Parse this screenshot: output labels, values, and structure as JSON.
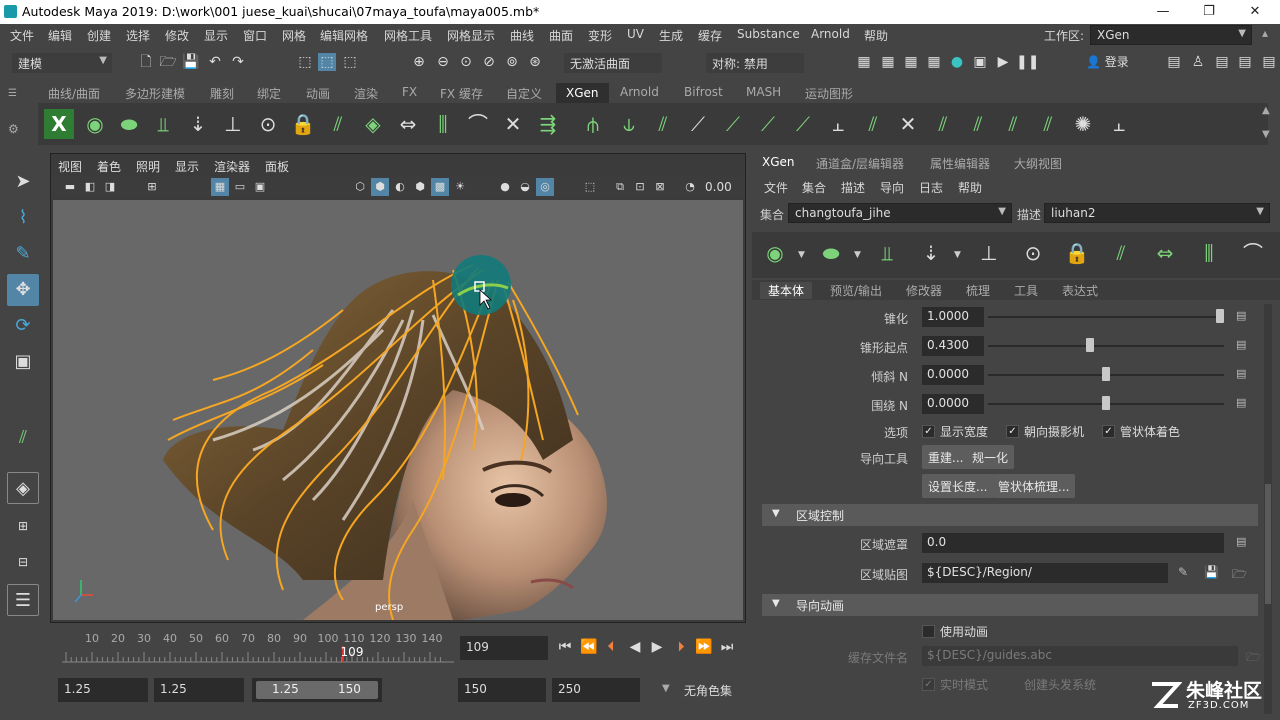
{
  "title_bar": {
    "title": "Autodesk Maya 2019: D:\\work\\001 juese_kuai\\shucai\\07maya_toufa\\maya005.mb*",
    "minimize": "—",
    "restore": "❐",
    "close": "✕"
  },
  "menu": [
    "文件",
    "编辑",
    "创建",
    "选择",
    "修改",
    "显示",
    "窗口",
    "网格",
    "编辑网格",
    "网格工具",
    "网格显示",
    "曲线",
    "曲面",
    "变形",
    "UV",
    "生成",
    "缓存",
    "Substance",
    "Arnold",
    "帮助"
  ],
  "workspace": {
    "label": "工作区:",
    "value": "XGen"
  },
  "status_line": {
    "mode": "建模",
    "live_surface": "无激活曲面",
    "symmetry": "对称: 禁用",
    "login": "登录"
  },
  "shelf_tabs": [
    "曲线/曲面",
    "多边形建模",
    "雕刻",
    "绑定",
    "动画",
    "渲染",
    "FX",
    "FX 缓存",
    "自定义",
    "XGen",
    "Arnold",
    "Bifrost",
    "MASH",
    "运动图形"
  ],
  "shelf_active": "XGen",
  "viewport": {
    "menus": [
      "视图",
      "着色",
      "照明",
      "显示",
      "渲染器",
      "面板"
    ],
    "exposure": "0.00",
    "camera_label": "persp"
  },
  "timeline": {
    "ticks": [
      "10",
      "20",
      "30",
      "40",
      "50",
      "60",
      "70",
      "80",
      "90",
      "100",
      "110",
      "120",
      "130",
      "140"
    ],
    "current_frame_marker": "109",
    "current_frame": "109"
  },
  "range": {
    "start": "1.25",
    "anim_start": "1.25",
    "slider_start": "1.25",
    "slider_end": "150",
    "anim_end": "150",
    "end": "250",
    "character_set": "无角色集"
  },
  "right_panel": {
    "tabs": [
      "XGen",
      "通道盒/层编辑器",
      "属性编辑器",
      "大纲视图"
    ],
    "active_tab": "XGen",
    "menus": [
      "文件",
      "集合",
      "描述",
      "导向",
      "日志",
      "帮助"
    ],
    "collection_label": "集合",
    "collection_value": "changtoufa_jihe",
    "description_label": "描述",
    "description_value": "liuhan2",
    "subtabs": [
      "基本体",
      "预览/输出",
      "修改器",
      "梳理",
      "工具",
      "表达式"
    ],
    "active_subtab": "基本体",
    "params": [
      {
        "label": "锥化",
        "value": "1.0000",
        "slider": 1.0
      },
      {
        "label": "锥形起点",
        "value": "0.4300",
        "slider": 0.43
      },
      {
        "label": "倾斜 N",
        "value": "0.0000",
        "slider": 0.5
      },
      {
        "label": "围绕 N",
        "value": "0.0000",
        "slider": 0.5
      }
    ],
    "options_label": "选项",
    "options": [
      {
        "label": "显示宽度",
        "checked": true
      },
      {
        "label": "朝向摄影机",
        "checked": true
      },
      {
        "label": "管状体着色",
        "checked": true
      }
    ],
    "guide_tools_label": "导向工具",
    "guide_buttons": [
      "重建...",
      "规一化",
      "设置长度...",
      "管状体梳理..."
    ],
    "region_section": "区域控制",
    "region_mask_label": "区域遮罩",
    "region_mask_value": "0.0",
    "region_map_label": "区域贴图",
    "region_map_value": "${DESC}/Region/",
    "guide_anim_section": "导向动画",
    "use_anim_label": "使用动画",
    "cache_file_label": "缓存文件名",
    "cache_file_value": "${DESC}/guides.abc",
    "realtime_label": "实时模式",
    "create_hair_label": "创建头发系统"
  },
  "watermark": {
    "text": "朱峰社区",
    "url": "ZF3D.COM"
  },
  "colors": {
    "selected_tool": "#5285a6",
    "shelf_green": "#7cd37a",
    "hair_orange": "#f5a623",
    "brush_circle": "#127a7a"
  }
}
